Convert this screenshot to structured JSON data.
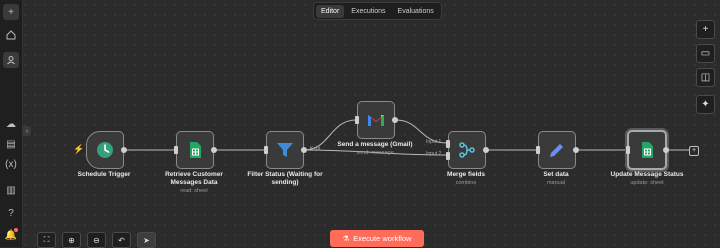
{
  "tabs": [
    "Editor",
    "Executions",
    "Evaluations"
  ],
  "execute_label": "Execute workflow",
  "accent": "#ff6d5a",
  "nodes": {
    "schedule": {
      "label": "Schedule Trigger",
      "icon": "clock-icon"
    },
    "retrieve": {
      "label": "Retrieve Customer Messages Data",
      "sub": "read: sheet",
      "icon": "google-sheets-icon"
    },
    "filter": {
      "label": "Filter Status (Waiting for sending)",
      "icon": "filter-icon"
    },
    "gmail": {
      "label": "Send a message (Gmail)",
      "sub": "send: message",
      "icon": "gmail-icon"
    },
    "merge": {
      "label": "Merge fields",
      "sub": "combine",
      "icon": "merge-icon"
    },
    "setdata": {
      "label": "Set data",
      "sub": "manual",
      "icon": "pencil-icon"
    },
    "update": {
      "label": "Update Message Status",
      "sub": "update: sheet",
      "icon": "google-sheets-icon"
    }
  },
  "edge_labels": {
    "kept": "Kept",
    "input1": "Input 1",
    "input2": "Input 2"
  }
}
